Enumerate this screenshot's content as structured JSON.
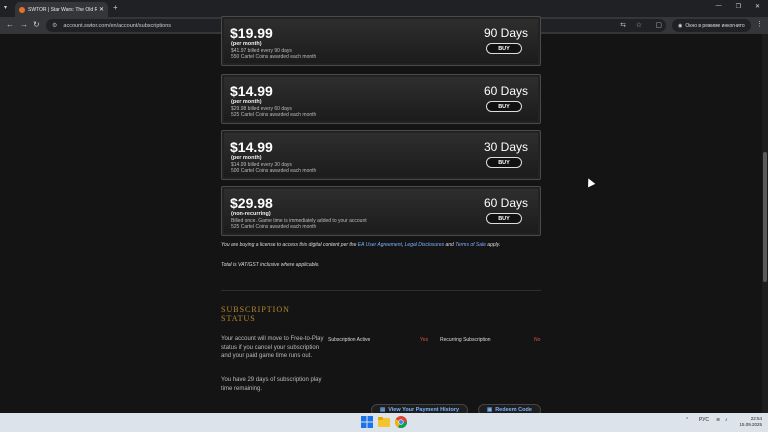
{
  "browser": {
    "tab_title": "SWTOR | Star Wars: The Old R...",
    "url": "account.swtor.com/en/account/subscriptions",
    "incognito_label": "Окно в режиме инкогнито"
  },
  "plans": [
    {
      "price": "$19.99",
      "term": "(per month)",
      "line1": "$41.97 billed every 90 days",
      "line2": "550 Cartel Coins awarded each month",
      "days": "90 Days",
      "buy": "BUY"
    },
    {
      "price": "$14.99",
      "term": "(per month)",
      "line1": "$29.98 billed every 60 days",
      "line2": "525 Cartel Coins awarded each month",
      "days": "60 Days",
      "buy": "BUY"
    },
    {
      "price": "$14.99",
      "term": "(per month)",
      "line1": "$14.99 billed every 30 days",
      "line2": "500 Cartel Coins awarded each month",
      "days": "30 Days",
      "buy": "BUY"
    },
    {
      "price": "$29.98",
      "term": "(non-recurring)",
      "line1": "Billed once. Game time is immediately added to your account",
      "line2": "525 Cartel Coins awarded each month",
      "days": "60 Days",
      "buy": "BUY"
    }
  ],
  "legal": {
    "prefix": "You are buying a license to access this digital content per the ",
    "link1": "EA User Agreement",
    "sep": ", ",
    "link2": "Legal Disclosures",
    "and": " and ",
    "link3": "Terms of Sale",
    "suffix": " apply.",
    "vat": "Total is VAT/GST inclusive where applicable."
  },
  "status": {
    "title_line1": "SUBSCRIPTION",
    "title_line2": "STATUS",
    "para1": "Your account will move to Free-to-Play status if you cancel your subscription and your paid game time runs out.",
    "para2": "You have 29 days of subscription play time remaining.",
    "active_label": "Subscription Active",
    "active_value": "Yes",
    "recurring_label": "Recurring Subscription",
    "recurring_value": "No",
    "history_button": "View Your Payment History",
    "redeem_button": "Redeem Code"
  },
  "taskbar": {
    "lang": "РУС",
    "time": "22:54",
    "date": "15.09.2025"
  }
}
